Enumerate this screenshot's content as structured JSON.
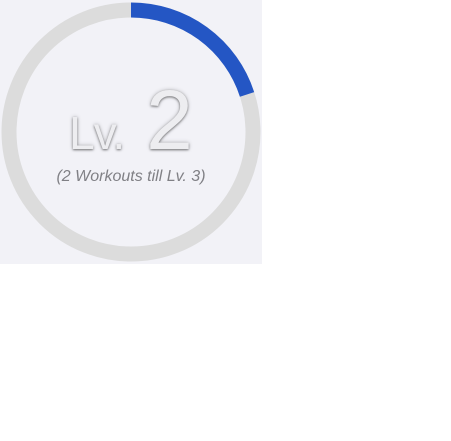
{
  "level_widget": {
    "level_prefix": "Lv.",
    "level_number": "2",
    "progress_caption": "(2 Workouts till Lv. 3)",
    "progress_fraction": 0.2,
    "colors": {
      "progress": "#2456c4",
      "track": "#dcdcdc",
      "background": "#f2f2f7",
      "caption": "#808085"
    }
  }
}
